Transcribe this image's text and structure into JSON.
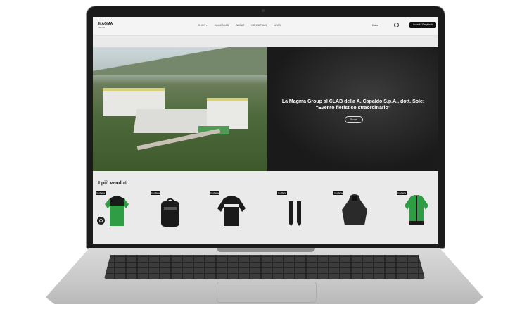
{
  "site": {
    "logo": "MAGMA",
    "logo_sub": "SPORT",
    "nav": [
      "SHOP ▾",
      "MAGMA LAB",
      "ABOUT",
      "CONTATTACI",
      "NEWS"
    ],
    "language": "Italia",
    "login_button": "Accedi / Registrati"
  },
  "hero": {
    "title": "La Magma Group al CLAB della A. Capaldo S.p.A., dott. Sole: “Evento fieristico straordinario”",
    "button": "Scopri"
  },
  "best_sellers": {
    "title": "I più venduti",
    "products": [
      {
        "badge": "In offerta",
        "icon": "green-jersey-icon"
      },
      {
        "badge": "In offerta",
        "icon": "backpack-icon"
      },
      {
        "badge": "In offerta",
        "icon": "sweatshirt-icon"
      },
      {
        "badge": "In offerta",
        "icon": "socks-icon"
      },
      {
        "badge": "In offerta",
        "icon": "hooded-jacket-icon"
      },
      {
        "badge": "In offerta",
        "icon": "track-jacket-icon"
      }
    ]
  },
  "colors": {
    "accent": "#2e9d44",
    "topbar": "#f4f4f4",
    "dark": "#1b1b1b"
  }
}
